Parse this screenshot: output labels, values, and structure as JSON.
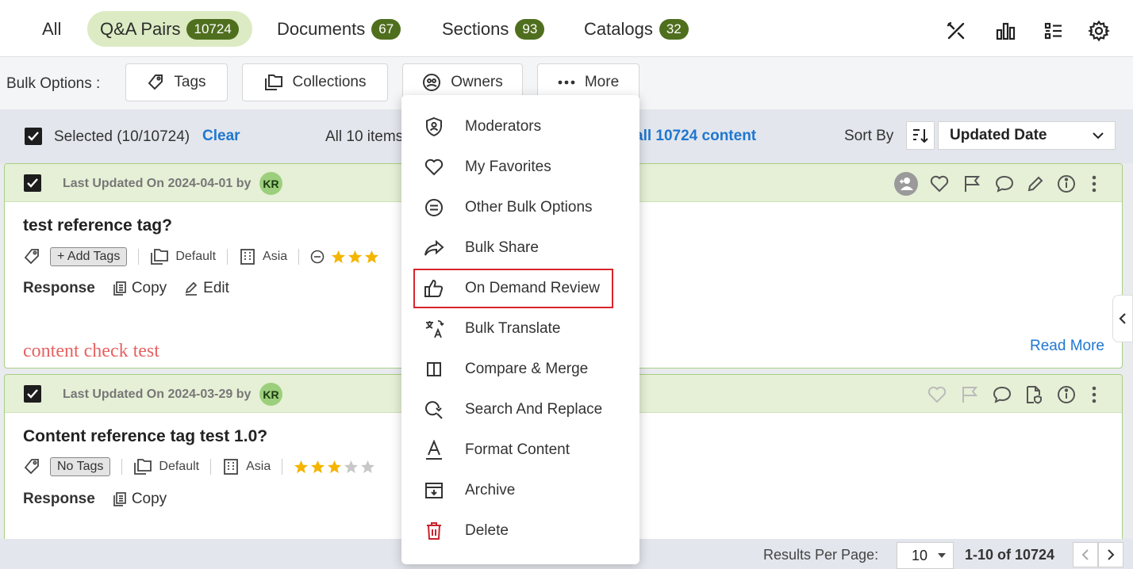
{
  "tabs": [
    {
      "label": "All",
      "count": ""
    },
    {
      "label": "Q&A Pairs",
      "count": "10724"
    },
    {
      "label": "Documents",
      "count": "67"
    },
    {
      "label": "Sections",
      "count": "93"
    },
    {
      "label": "Catalogs",
      "count": "32"
    }
  ],
  "bulk": {
    "label": "Bulk Options :",
    "tags": "Tags",
    "collections": "Collections",
    "owners": "Owners",
    "more": "More"
  },
  "selection": {
    "selected": "Selected (10/10724)",
    "clear": "Clear",
    "all_items": "All 10 items",
    "select_all": "all 10724 content",
    "sort_by": "Sort By",
    "sort_value": "Updated Date"
  },
  "cards": [
    {
      "updated": "Last Updated On 2024-04-01 by",
      "avatar": "KR",
      "title": "test reference tag?",
      "tag_pill": "+ Add Tags",
      "collection": "Default",
      "region": "Asia",
      "response": "Response",
      "copy": "Copy",
      "edit": "Edit",
      "preview": "content check test",
      "read_more": "Read More"
    },
    {
      "updated": "Last Updated On 2024-03-29 by",
      "avatar": "KR",
      "title": "Content reference tag test 1.0?",
      "tag_pill": "No Tags",
      "collection": "Default",
      "region": "Asia",
      "response": "Response",
      "copy": "Copy",
      "rating": 3
    }
  ],
  "menu": {
    "items": [
      {
        "label": "Moderators",
        "icon": "shield-user-icon"
      },
      {
        "label": "My Favorites",
        "icon": "heart-icon"
      },
      {
        "label": "Other Bulk Options",
        "icon": "equals-circle-icon"
      },
      {
        "label": "Bulk Share",
        "icon": "share-arrow-icon"
      },
      {
        "label": "On Demand Review",
        "icon": "thumbs-up-icon"
      },
      {
        "label": "Bulk Translate",
        "icon": "translate-icon"
      },
      {
        "label": "Compare & Merge",
        "icon": "compare-icon"
      },
      {
        "label": "Search And Replace",
        "icon": "search-replace-icon"
      },
      {
        "label": "Format Content",
        "icon": "format-text-icon"
      },
      {
        "label": "Archive",
        "icon": "archive-icon"
      },
      {
        "label": "Delete",
        "icon": "trash-icon"
      }
    ]
  },
  "footer": {
    "results_per_page": "Results Per Page:",
    "per_page_value": "10",
    "range": "1-10 of 10724"
  },
  "colors": {
    "accent_green": "#4f6f1e",
    "active_tab": "#dcebc3",
    "link_blue": "#1f77d0",
    "highlight_red": "#d9262c",
    "delete_red": "#c8242b"
  }
}
